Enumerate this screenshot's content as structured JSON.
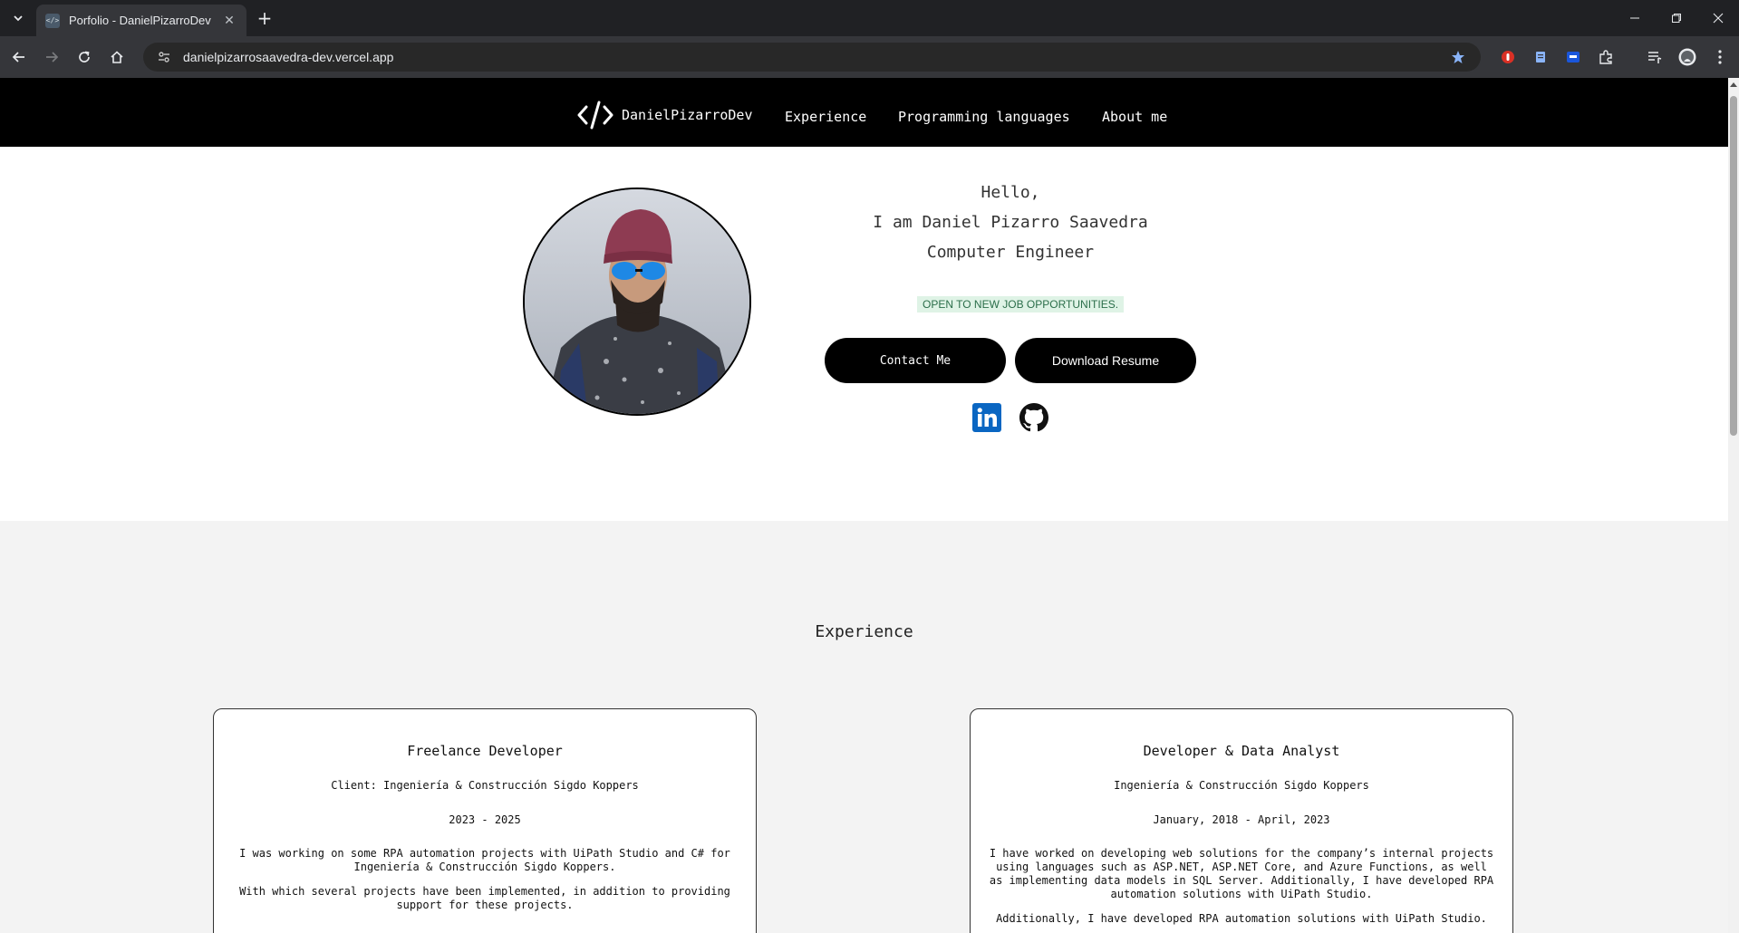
{
  "browser": {
    "tab_title": "Porfolio - DanielPizarroDev",
    "url": "danielpizarrosaavedra-dev.vercel.app"
  },
  "site": {
    "brand": "DanielPizarroDev",
    "nav": [
      "Experience",
      "Programming languages",
      "About me"
    ]
  },
  "hero": {
    "greeting": "Hello,",
    "name_line": "I am Daniel Pizarro Saavedra",
    "title": "Computer Engineer",
    "badge": "OPEN TO NEW JOB OPPORTUNITIES.",
    "contact_button": "Contact Me",
    "resume_button": "Download Resume",
    "socials": [
      "linkedin-icon",
      "github-icon"
    ]
  },
  "experience": {
    "heading": "Experience",
    "cards": [
      {
        "role": "Freelance Developer",
        "company": "Client: Ingeniería & Construcción Sigdo Koppers",
        "period": "2023 - 2025",
        "desc1": "I was working on some RPA automation projects with UiPath Studio and C# for Ingeniería & Construcción Sigdo Koppers.",
        "desc2": "With which several projects have been implemented, in addition to providing support for these projects."
      },
      {
        "role": "Developer & Data Analyst",
        "company": "Ingeniería & Construcción Sigdo Koppers",
        "period": "January, 2018 - April, 2023",
        "desc1": "I have worked on developing web solutions for the company’s internal projects using languages such as ASP.NET, ASP.NET Core, and Azure Functions, as well as implementing data models in SQL Server. Additionally, I have developed RPA automation solutions with UiPath Studio.",
        "desc2": "Additionally, I have developed RPA automation solutions with UiPath Studio."
      }
    ]
  },
  "colors": {
    "nav_bg": "#000000",
    "page_bg": "#f3f3f3",
    "badge_bg": "#dff3e6",
    "badge_text": "#2b6e4a",
    "linkedin": "#0a66c2"
  }
}
